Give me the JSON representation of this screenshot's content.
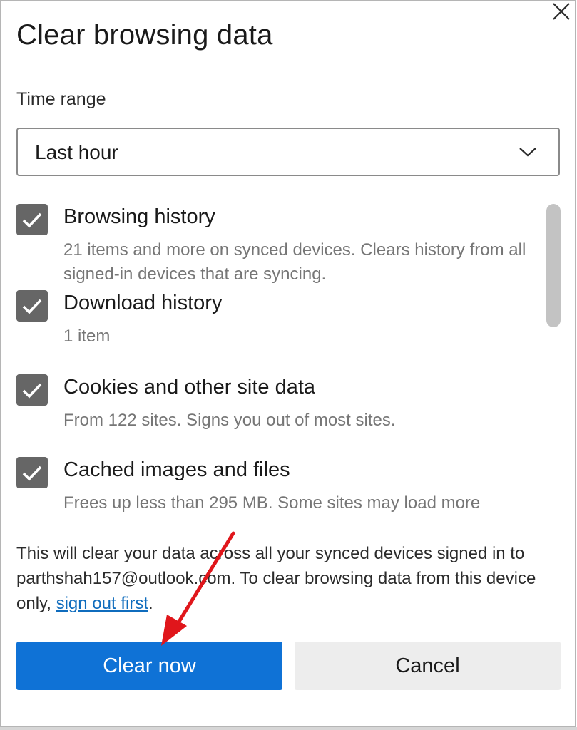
{
  "dialog": {
    "title": "Clear browsing data",
    "close_icon": "close-icon"
  },
  "time_range": {
    "label": "Time range",
    "selected": "Last hour",
    "chevron_icon": "chevron-down-icon"
  },
  "items": [
    {
      "title": "Browsing history",
      "description": "21 items and more on synced devices. Clears history from all signed-in devices that are syncing.",
      "checked": true
    },
    {
      "title": "Download history",
      "description": "1 item",
      "checked": true
    },
    {
      "title": "Cookies and other site data",
      "description": "From 122 sites. Signs you out of most sites.",
      "checked": true
    },
    {
      "title": "Cached images and files",
      "description": "Frees up less than 295 MB. Some sites may load more",
      "checked": true
    }
  ],
  "notice": {
    "text_before": "This will clear your data across all your synced devices signed in to parthshah157@outlook.com. To clear browsing data from this device only, ",
    "link": "sign out first",
    "text_after": "."
  },
  "buttons": {
    "primary": "Clear now",
    "secondary": "Cancel"
  },
  "colors": {
    "primary_button": "#0f72d6",
    "secondary_button": "#ededed",
    "checkbox": "#666666",
    "link": "#0f6cbd",
    "annotation_arrow": "#e0161b"
  }
}
